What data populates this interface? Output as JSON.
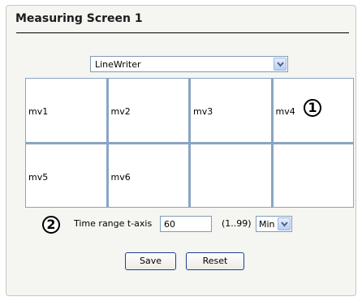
{
  "title": "Measuring Screen 1",
  "view_select": {
    "value": "LineWriter"
  },
  "cells": [
    {
      "label": "mv1"
    },
    {
      "label": "mv2"
    },
    {
      "label": "mv3"
    },
    {
      "label": "mv4"
    },
    {
      "label": "mv5"
    },
    {
      "label": "mv6"
    },
    {
      "label": ""
    },
    {
      "label": ""
    }
  ],
  "markers": {
    "one": "1",
    "two": "2"
  },
  "time_range": {
    "label": "Time range t-axis",
    "value": "60",
    "range_hint": "(1..99)",
    "unit": "Min"
  },
  "buttons": {
    "save": "Save",
    "reset": "Reset"
  },
  "colors": {
    "grid_border": "#8aa4c4",
    "button_border": "#1c3f94",
    "panel_bg": "#f5f5f1"
  },
  "icons": {
    "dropdown": "chevron-down-icon"
  }
}
